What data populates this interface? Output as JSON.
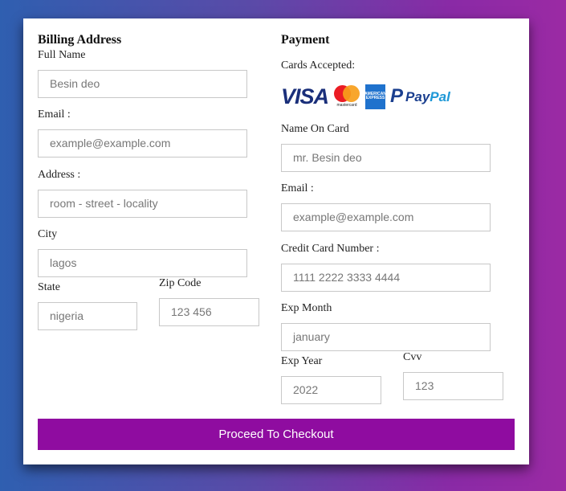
{
  "billing": {
    "title": "Billing Address",
    "full_name": {
      "label": "Full Name",
      "placeholder": "Besin deo"
    },
    "email": {
      "label": "Email :",
      "placeholder": "example@example.com"
    },
    "address": {
      "label": "Address :",
      "placeholder": "room - street - locality"
    },
    "city": {
      "label": "City",
      "placeholder": "lagos"
    },
    "state": {
      "label": "State",
      "placeholder": "nigeria"
    },
    "zip": {
      "label": "Zip Code",
      "placeholder": "123 456"
    }
  },
  "payment": {
    "title": "Payment",
    "cards_accepted_label": "Cards Accepted:",
    "card_logos": {
      "visa": "VISA",
      "mastercard": "mastercard",
      "amex": "AMERICAN EXPRESS",
      "paypal_pay": "Pay",
      "paypal_pal": "Pal"
    },
    "name_on_card": {
      "label": "Name On Card",
      "placeholder": "mr. Besin deo"
    },
    "email": {
      "label": "Email :",
      "placeholder": "example@example.com"
    },
    "card_number": {
      "label": "Credit Card Number :",
      "placeholder": "1111 2222 3333 4444"
    },
    "exp_month": {
      "label": "Exp Month",
      "placeholder": "january"
    },
    "exp_year": {
      "label": "Exp Year",
      "placeholder": "2022"
    },
    "cvv": {
      "label": "Cvv",
      "placeholder": "123"
    }
  },
  "submit_label": "Proceed To Checkout",
  "colors": {
    "accent": "#8f0ca0",
    "card_bg": "#ffffff"
  }
}
